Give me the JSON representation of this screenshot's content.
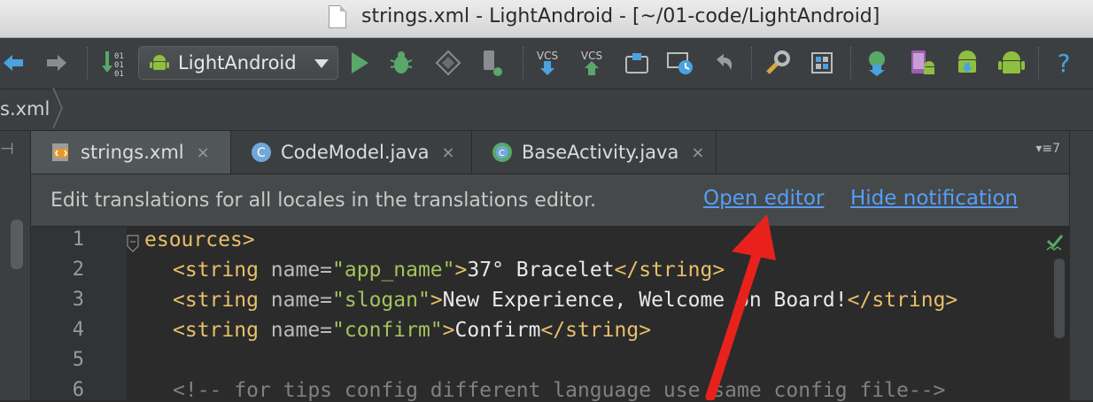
{
  "window": {
    "title": "strings.xml - LightAndroid - [~/01-code/LightAndroid]"
  },
  "toolbar": {
    "run_config": "LightAndroid",
    "vcs_label": "VCS",
    "help_label": "?"
  },
  "breadcrumb": {
    "item": "s.xml"
  },
  "tabs": [
    {
      "label": "strings.xml",
      "close": "×",
      "icon": "xml-file-icon"
    },
    {
      "label": "CodeModel.java",
      "close": "×",
      "icon": "class-icon"
    },
    {
      "label": "BaseActivity.java",
      "close": "×",
      "icon": "activity-class-icon"
    }
  ],
  "tab_overflow": "7",
  "notification": {
    "text": "Edit translations for all locales in the translations editor.",
    "open_editor": "Open editor",
    "hide_notification": "Hide notification"
  },
  "editor": {
    "line_numbers": [
      "1",
      "2",
      "3",
      "4",
      "5",
      "6"
    ],
    "lines": [
      {
        "tag_open": "esources>"
      },
      {
        "tag_start": "<string",
        "attr": " name=",
        "value": "\"app_name\"",
        "gt": ">",
        "text": "37° Bracelet",
        "tag_end": "</string>"
      },
      {
        "tag_start": "<string",
        "attr": " name=",
        "value": "\"slogan\"",
        "gt": ">",
        "text": "New Experience, Welcome on Board!",
        "tag_end": "</string>"
      },
      {
        "tag_start": "<string",
        "attr": " name=",
        "value": "\"confirm\"",
        "gt": ">",
        "text": "Confirm",
        "tag_end": "</string>"
      },
      {},
      {
        "comment": "<!-- for tips config different language use same config file-->"
      }
    ]
  },
  "colors": {
    "link": "#589df6",
    "tag": "#e8bf6a",
    "string_value": "#a5c25c",
    "annotation_arrow": "#e8211d"
  }
}
